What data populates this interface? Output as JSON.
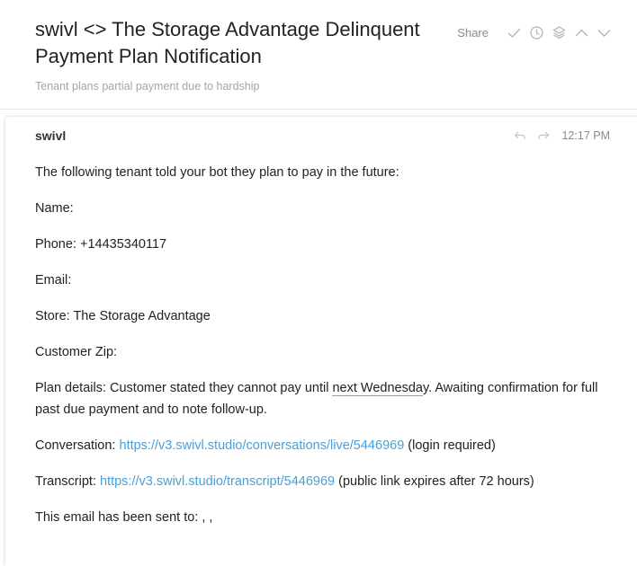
{
  "header": {
    "subject": "swivl <> The Storage Advantage Delinquent Payment Plan Notification",
    "summary": "Tenant plans partial payment due to hardship",
    "share_label": "Share",
    "icons": [
      "check-icon",
      "clock-icon",
      "layers-icon",
      "chevron-up-icon",
      "chevron-down-icon"
    ]
  },
  "message": {
    "sender": "swivl",
    "time": "12:17 PM",
    "icons": [
      "reply-icon",
      "forward-icon"
    ],
    "intro": "The following tenant told your bot they plan to pay in the future:",
    "name": "Name:",
    "phone": "Phone: +14435340117",
    "email": "Email:",
    "store": "Store: The Storage Advantage",
    "zip": "Customer Zip:",
    "plan": {
      "prefix": "Plan details: Customer stated they cannot pay until ",
      "date_text": "next Wednesda",
      "suffix": "y. Awaiting confirmation for full past due payment and to note follow-up."
    },
    "conversation": {
      "label": "Conversation: ",
      "url": "https://v3.swivl.studio/conversations/live/5446969",
      "note": " (login required)"
    },
    "transcript": {
      "label": "Transcript: ",
      "url": "https://v3.swivl.studio/transcript/5446969",
      "note": " (public link expires after 72 hours)"
    },
    "sent_to": "This email has been sent to: , ,"
  },
  "colors": {
    "link": "#4a9fd8",
    "muted": "#a5a5a5",
    "text": "#222222"
  }
}
